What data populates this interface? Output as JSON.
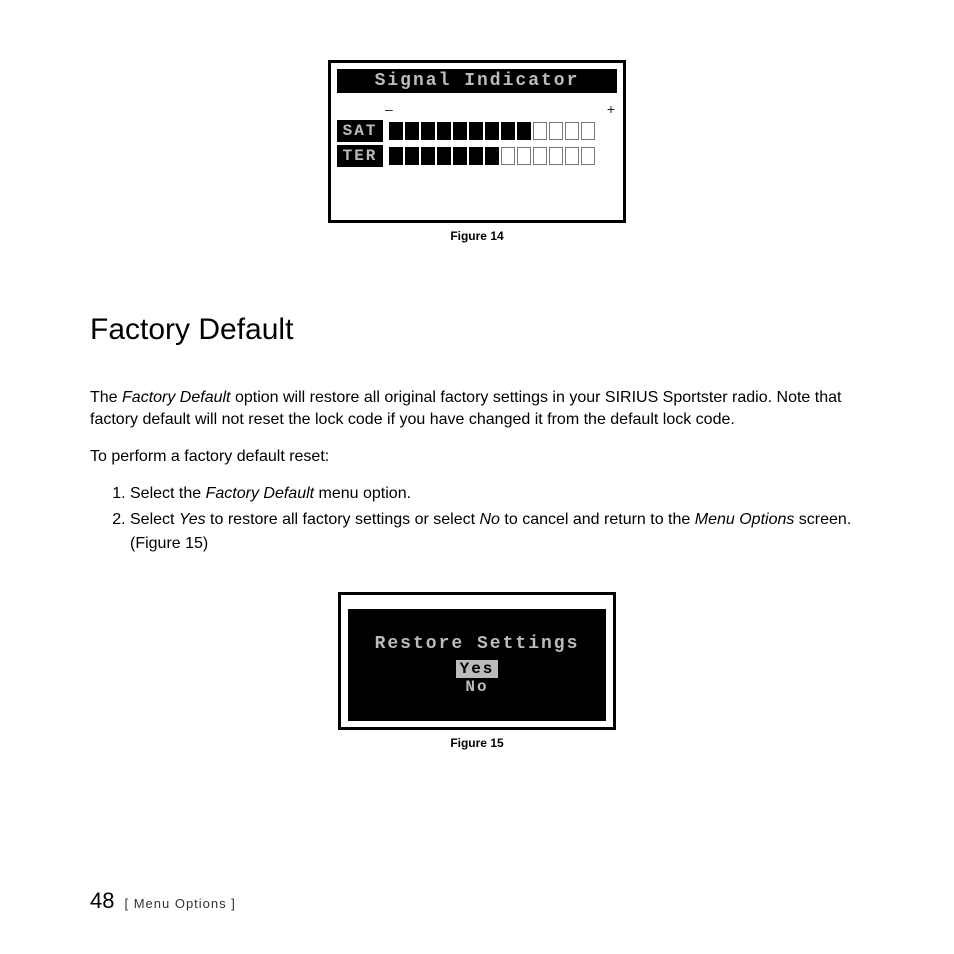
{
  "figure14": {
    "title": "Signal Indicator",
    "scale_low": "–",
    "scale_high": "+",
    "rows": [
      {
        "label": "SAT",
        "filled": 9,
        "total": 13
      },
      {
        "label": "TER",
        "filled": 7,
        "total": 13
      }
    ],
    "caption": "Figure 14"
  },
  "section": {
    "heading": "Factory Default",
    "para1_prefix": "The ",
    "para1_em1": "Factory Default",
    "para1_rest": " option will restore all original factory settings in your SIRIUS Sportster radio. Note that factory default will not reset the lock code if you have changed it from the default lock code.",
    "para2": "To perform a factory default reset:",
    "steps": [
      {
        "prefix": "Select the ",
        "em": "Factory Default",
        "suffix": " menu option."
      },
      {
        "plain": "Select ",
        "em1": "Yes",
        "mid": " to restore all factory settings or select ",
        "em2": "No",
        "mid2": " to cancel and return to the ",
        "em3": "Menu Options",
        "suffix": " screen. (Figure 15)"
      }
    ]
  },
  "figure15": {
    "title": "Restore Settings",
    "options": [
      {
        "label": "Yes",
        "selected": true
      },
      {
        "label": "No",
        "selected": false
      }
    ],
    "caption": "Figure 15"
  },
  "footer": {
    "page_number": "48",
    "section_label": "[ Menu Options ]"
  }
}
